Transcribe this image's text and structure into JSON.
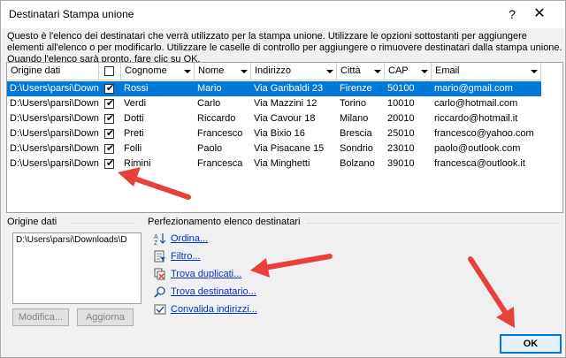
{
  "window": {
    "title": "Destinatari Stampa unione",
    "help_glyph": "?",
    "close_glyph": "✕"
  },
  "description": "Questo è l'elenco dei destinatari che verrà utilizzato per la stampa unione. Utilizzare le opzioni sottostanti per aggiungere elementi all'elenco o per modificarlo. Utilizzare le caselle di controllo per aggiungere o rimuovere destinatari dalla stampa unione. Quando l'elenco sarà pronto, fare clic su OK.",
  "table": {
    "columns": [
      "Origine dati",
      "",
      "Cognome",
      "Nome",
      "Indirizzo",
      "Città",
      "CAP",
      "Email"
    ],
    "rows": [
      {
        "source": "D:\\Users\\parsi\\Downl...",
        "checked": "✔",
        "cognome": "Rossi",
        "nome": "Mario",
        "indirizzo": "Via Garibaldi 23",
        "citta": "Firenze",
        "cap": "50100",
        "email": "mario@gmail.com"
      },
      {
        "source": "D:\\Users\\parsi\\Downl...",
        "checked": "✔",
        "cognome": "Verdi",
        "nome": "Carlo",
        "indirizzo": "Via Mazzini 12",
        "citta": "Torino",
        "cap": "10010",
        "email": "carlo@hotmail.com"
      },
      {
        "source": "D:\\Users\\parsi\\Downl...",
        "checked": "✔",
        "cognome": "Dotti",
        "nome": "Riccardo",
        "indirizzo": "Via Cavour 18",
        "citta": "Milano",
        "cap": "20010",
        "email": "riccardo@hotmail.it"
      },
      {
        "source": "D:\\Users\\parsi\\Downl...",
        "checked": "✔",
        "cognome": "Preti",
        "nome": "Francesco",
        "indirizzo": "Via Bixio 16",
        "citta": "Brescia",
        "cap": "25010",
        "email": "francesco@yahoo.com"
      },
      {
        "source": "D:\\Users\\parsi\\Downl...",
        "checked": "✔",
        "cognome": "Folli",
        "nome": "Paolo",
        "indirizzo": "Via Pisacane 15",
        "citta": "Sondrio",
        "cap": "23010",
        "email": "paolo@outlook.com"
      },
      {
        "source": "D:\\Users\\parsi\\Downl...",
        "checked": "✔",
        "cognome": "Rimini",
        "nome": "Francesca",
        "indirizzo": "Via Minghetti",
        "citta": "Bolzano",
        "cap": "39010",
        "email": "francesca@outlook.it"
      }
    ]
  },
  "data_source": {
    "label": "Origine dati",
    "item": "D:\\Users\\parsi\\Downloads\\D",
    "modify_label": "Modifica...",
    "refresh_label": "Aggiorna"
  },
  "refine": {
    "label": "Perfezionamento elenco destinatari",
    "links": [
      "Ordina...",
      "Filtro...",
      "Trova duplicati...",
      "Trova destinatario...",
      "Convalida indirizzi..."
    ]
  },
  "ok_label": "OK",
  "colors": {
    "selection": "#0078d7",
    "link": "#0033cc",
    "annotation_arrow": "#e8413c"
  }
}
